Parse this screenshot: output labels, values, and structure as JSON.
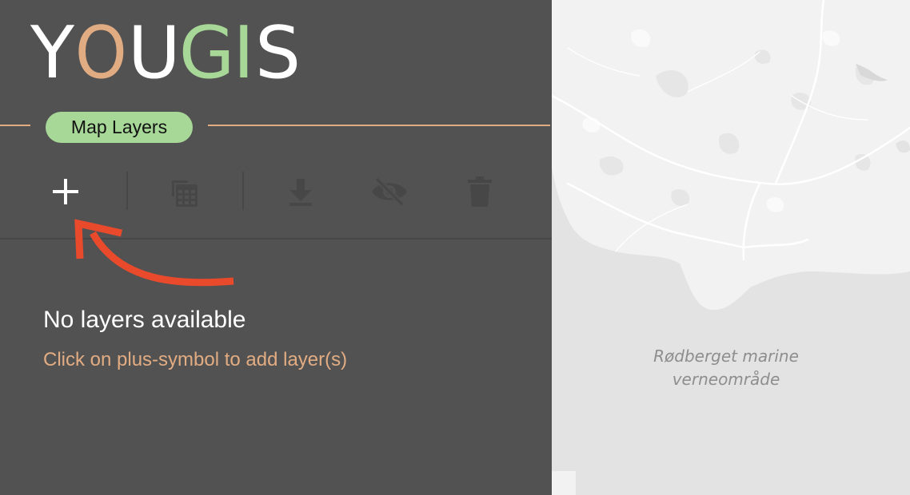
{
  "logo": {
    "letters": [
      {
        "char": "Y",
        "color": "#ffffff"
      },
      {
        "char": "O",
        "color": "#e2ac83"
      },
      {
        "char": "U",
        "color": "#ffffff"
      },
      {
        "char": "G",
        "color": "#a8d898"
      },
      {
        "char": "I",
        "color": "#a8d898"
      },
      {
        "char": "S",
        "color": "#ffffff"
      }
    ]
  },
  "section": {
    "label": "Map Layers",
    "tab_color": "#a8d898",
    "rule_color": "#e2ac83"
  },
  "toolbar": {
    "tools": [
      {
        "name": "add-layer",
        "icon": "plus-icon",
        "enabled": true
      },
      {
        "name": "layer-table",
        "icon": "table-icon",
        "enabled": false
      },
      {
        "name": "download",
        "icon": "download-icon",
        "enabled": false
      },
      {
        "name": "toggle-visibility",
        "icon": "eye-off-icon",
        "enabled": false
      },
      {
        "name": "delete-layer",
        "icon": "trash-icon",
        "enabled": false
      }
    ],
    "enabled_color": "#ffffff",
    "disabled_color": "#474747"
  },
  "annotation": {
    "icon": "curved-arrow-icon",
    "color": "#ea4a2c"
  },
  "empty_state": {
    "title": "No layers available",
    "hint": "Click on plus-symbol to add layer(s)",
    "hint_color": "#e2ac83"
  },
  "map": {
    "label_lines": [
      "Rødberget marine",
      "verneområde"
    ],
    "land_color": "#f2f2f2",
    "sea_color": "#e3e3e3"
  }
}
